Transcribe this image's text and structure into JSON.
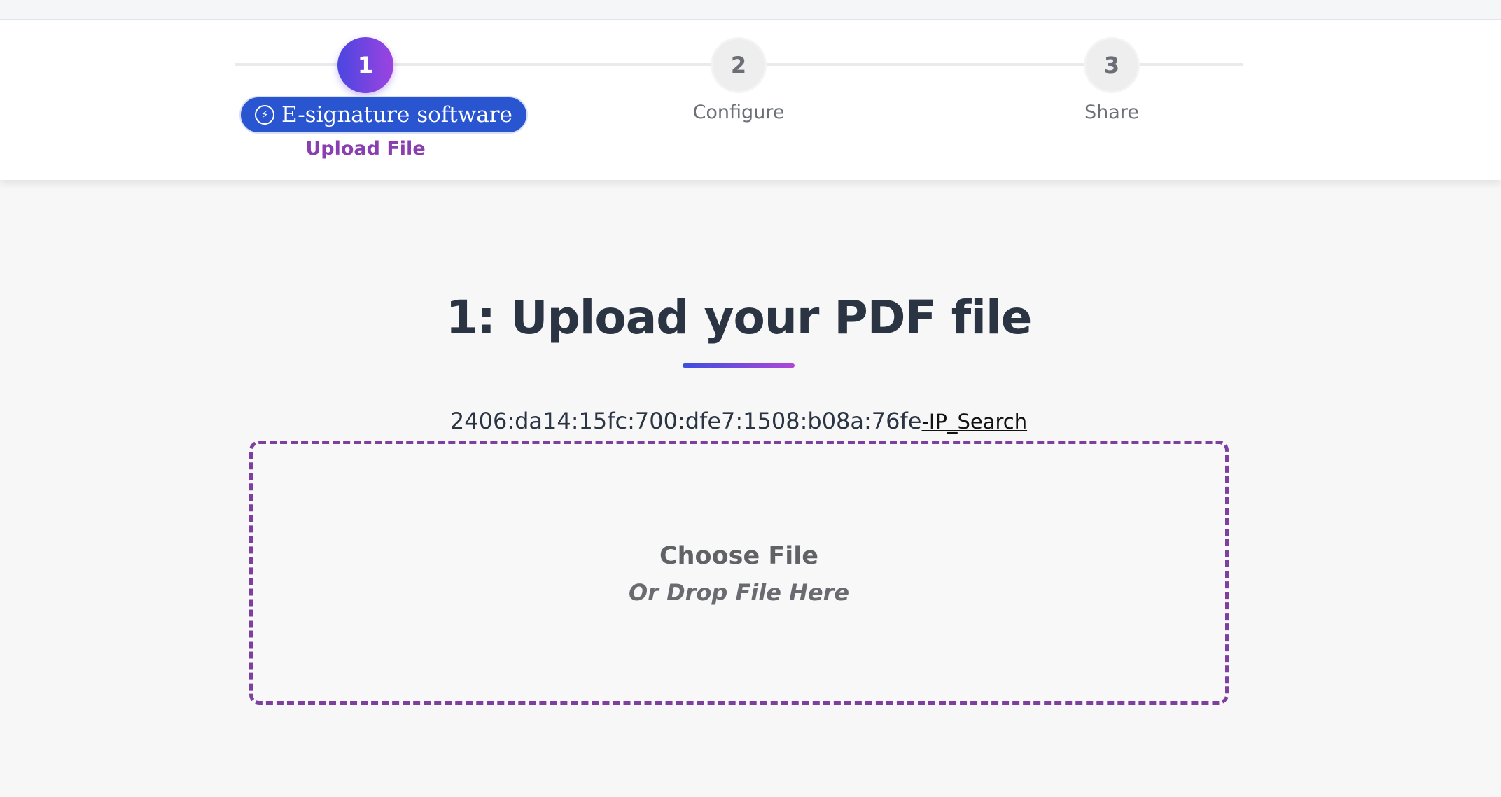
{
  "stepper": {
    "steps": [
      {
        "number": "1",
        "label": "Upload File",
        "state": "active"
      },
      {
        "number": "2",
        "label": "Configure",
        "state": "inactive"
      },
      {
        "number": "3",
        "label": "Share",
        "state": "inactive"
      }
    ],
    "ad_pill": {
      "icon": "bolt-icon",
      "text": "E-signature software"
    }
  },
  "main": {
    "title": "1: Upload your PDF file",
    "ip_text": "2406:da14:15fc:700:dfe7:1508:b08a:76fe",
    "ip_link": "-IP_Search",
    "dropzone": {
      "choose_label": "Choose File",
      "drop_hint": "Or Drop File Here"
    }
  },
  "colors": {
    "accent_purple": "#8a3fb0",
    "gradient_start": "#4a46e0",
    "gradient_end": "#9d43e0",
    "ad_blue": "#2a55d0",
    "title_text": "#2b3443"
  }
}
